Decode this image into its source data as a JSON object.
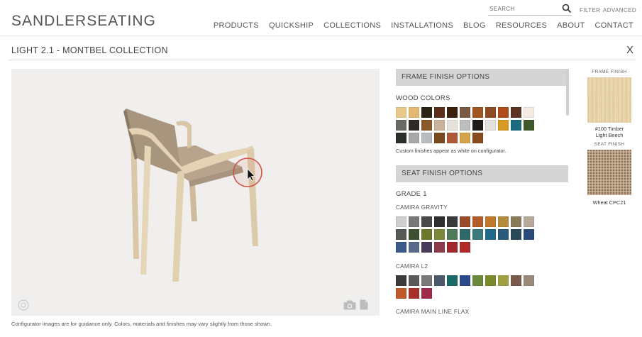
{
  "brand": {
    "part1": "SANDLER",
    "part2": "SEATING"
  },
  "search": {
    "placeholder": "SEARCH"
  },
  "header_links": {
    "filter": "FILTER",
    "advanced": "ADVANCED"
  },
  "nav": [
    "PRODUCTS",
    "QUICKSHIP",
    "COLLECTIONS",
    "INSTALLATIONS",
    "BLOG",
    "RESOURCES",
    "ABOUT",
    "CONTACT"
  ],
  "page": {
    "title": "LIGHT 2.1 - MONTBEL COLLECTION",
    "close": "X"
  },
  "viewer": {
    "disclaimer": "Configurator images are for guidance only. Colors, materials and finishes may vary slightly from those shown."
  },
  "frame": {
    "heading": "FRAME FINISH OPTIONS",
    "wood_label": "WOOD COLORS",
    "note": "Custom finishes appear as white on configurator.",
    "wood_colors": [
      "#e9c98b",
      "#e4ba72",
      "#2b2416",
      "#5a2e18",
      "#3b2010",
      "#7b5a43",
      "#a0541f",
      "#8e4a22",
      "#b04a1b",
      "#5b3422",
      "#f5ebe1",
      "#6a6a64",
      "#2e2a25",
      "#8b5a2b",
      "#c9b49a",
      "#e6e1da",
      "#bdbdbd",
      "#1e1b18",
      "#e4e2de",
      "#d89a20",
      "#1a6b7e",
      "#40582a",
      "#2a2f2a",
      "#a8a8a8",
      "#b9bcbf",
      "#7a4a1e",
      "#b0583a",
      "#d4a24a",
      "#8a4a20"
    ]
  },
  "seat": {
    "heading": "SEAT FINISH OPTIONS",
    "grade": "GRADE 1",
    "gravity": {
      "label": "CAMIRA GRAVITY",
      "colors": [
        "#cfcfcf",
        "#787878",
        "#4a4a4a",
        "#2f2f2f",
        "#3a3a3a",
        "#9a4b2a",
        "#b35d2b",
        "#c2782a",
        "#b48b3a",
        "#8a7a5a",
        "#b7a999",
        "#555a55",
        "#3d5030",
        "#6a7a2a",
        "#7a8a3a",
        "#4f7a5a",
        "#2f6a6a",
        "#3a7a7a",
        "#1f6a8a",
        "#2a5a7a",
        "#2a4a5a",
        "#2a4a7a",
        "#3a5a8a",
        "#5a6a8a",
        "#4a3a5a",
        "#8a3a4a",
        "#a0282a",
        "#b02a2a"
      ]
    },
    "l2": {
      "label": "CAMIRA L2",
      "colors": [
        "#3a3a3a",
        "#5a5a5a",
        "#7a7a7a",
        "#4a5a6a",
        "#1a6a6a",
        "#2a4a8a",
        "#6a8a3a",
        "#7a8a2a",
        "#a0a040",
        "#7a5a4a",
        "#9a8a7a",
        "#c05a2a",
        "#a8322a",
        "#a02a4a"
      ]
    },
    "flax_label": "CAMIRA MAIN LINE FLAX"
  },
  "preview": {
    "frame_label": "FRAME FINISH",
    "frame_caption_1": "#100 Timber",
    "frame_caption_2": "Light Beech",
    "seat_label": "SEAT FINISH",
    "seat_caption": "Wheat CPC21"
  }
}
